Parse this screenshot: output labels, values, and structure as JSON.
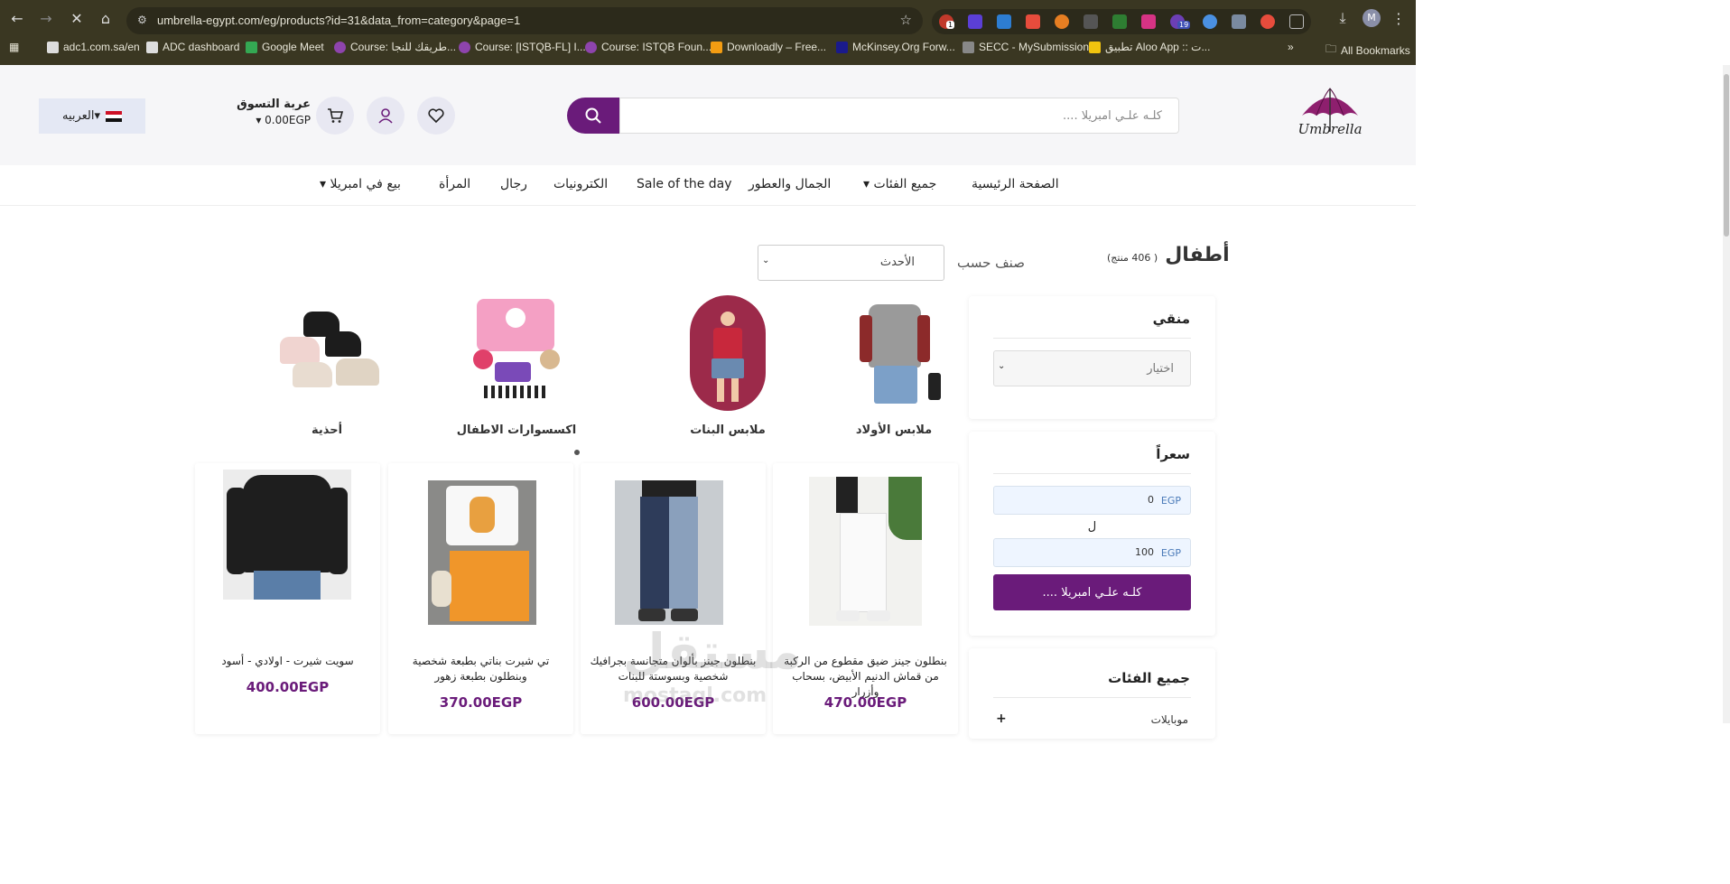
{
  "browser": {
    "url": "umbrella-egypt.com/eg/products?id=31&data_from=category&page=1",
    "bookmarks": [
      {
        "label": "adc1.com.sa/en",
        "color": "#dddddd"
      },
      {
        "label": "ADC dashboard",
        "color": "#dddddd"
      },
      {
        "label": "Google Meet",
        "color": "#34a853"
      },
      {
        "label": "Course: طريقك للنجا...",
        "color": "#8e44ad"
      },
      {
        "label": "Course: [ISTQB-FL] I...",
        "color": "#8e44ad"
      },
      {
        "label": "Course: ISTQB Foun...",
        "color": "#8e44ad"
      },
      {
        "label": "Downloadly – Free...",
        "color": "#f39c12"
      },
      {
        "label": "McKinsey.Org Forw...",
        "color": "#1a1a8c"
      },
      {
        "label": "SECC - MySubmission",
        "color": "#888888"
      },
      {
        "label": "تطبيق Aloo App :: ت...",
        "color": "#f1c40f"
      }
    ],
    "more_bookmarks": "»",
    "all_bookmarks": "All Bookmarks",
    "badges": {
      "ext1": "1",
      "ext2": "19"
    }
  },
  "header": {
    "logo_text": "Umbrella",
    "search_placeholder": "كلـه علـي امبريلا ....",
    "cart_title": "عربة التسوق",
    "cart_total": "▾ 0.00EGP",
    "language": "العربيه▾"
  },
  "menu": [
    "الصفحة الرئيسية",
    "جميع الفئات ▾",
    "الجمال والعطور",
    "Sale of the day",
    "الكترونيات",
    "رجال",
    "المرأة",
    "بيع في امبريلا ▾"
  ],
  "page": {
    "title": "أطفال",
    "count": "( 406 منتج)",
    "sort_label": "صنف حسب",
    "sort_value": "الأحدث"
  },
  "filters": {
    "brand_title": "منقي",
    "brand_select": "اختيار",
    "price_title": "سعراً",
    "price_min": "0",
    "price_max": "100",
    "currency": "EGP",
    "to_label": "ل",
    "price_button": "كلـه علـي امبريلا ....",
    "categories_title": "جميع الفئات",
    "categories_first": "موبايلات",
    "plus": "+"
  },
  "categories": [
    {
      "label": "ملابس الأولاد"
    },
    {
      "label": "ملابس البنات"
    },
    {
      "label": "اكسسوارات الاطفال"
    },
    {
      "label": "أحذية"
    }
  ],
  "products": [
    {
      "name": "بنطلون جينز ضيق مقطوع من الركبة من قماش الدنيم الأبيض، بسحاب وأزرار",
      "price": "470.00EGP"
    },
    {
      "name": "بنطلون جينز بألوان متجانسة بجرافيك شخصية وبسوستة للبنات",
      "price": "600.00EGP"
    },
    {
      "name": "تي شيرت بناتي بطبعة شخصية وبنطلون بطبعة زهور",
      "price": "370.00EGP"
    },
    {
      "name": "سويت شيرت - اولادي - أسود",
      "price": "400.00EGP"
    }
  ],
  "watermark": {
    "ar": "مستقل",
    "en": "mostaql.com"
  },
  "colors": {
    "brand": "#6a1b7a",
    "chrome": "#3a3722"
  }
}
